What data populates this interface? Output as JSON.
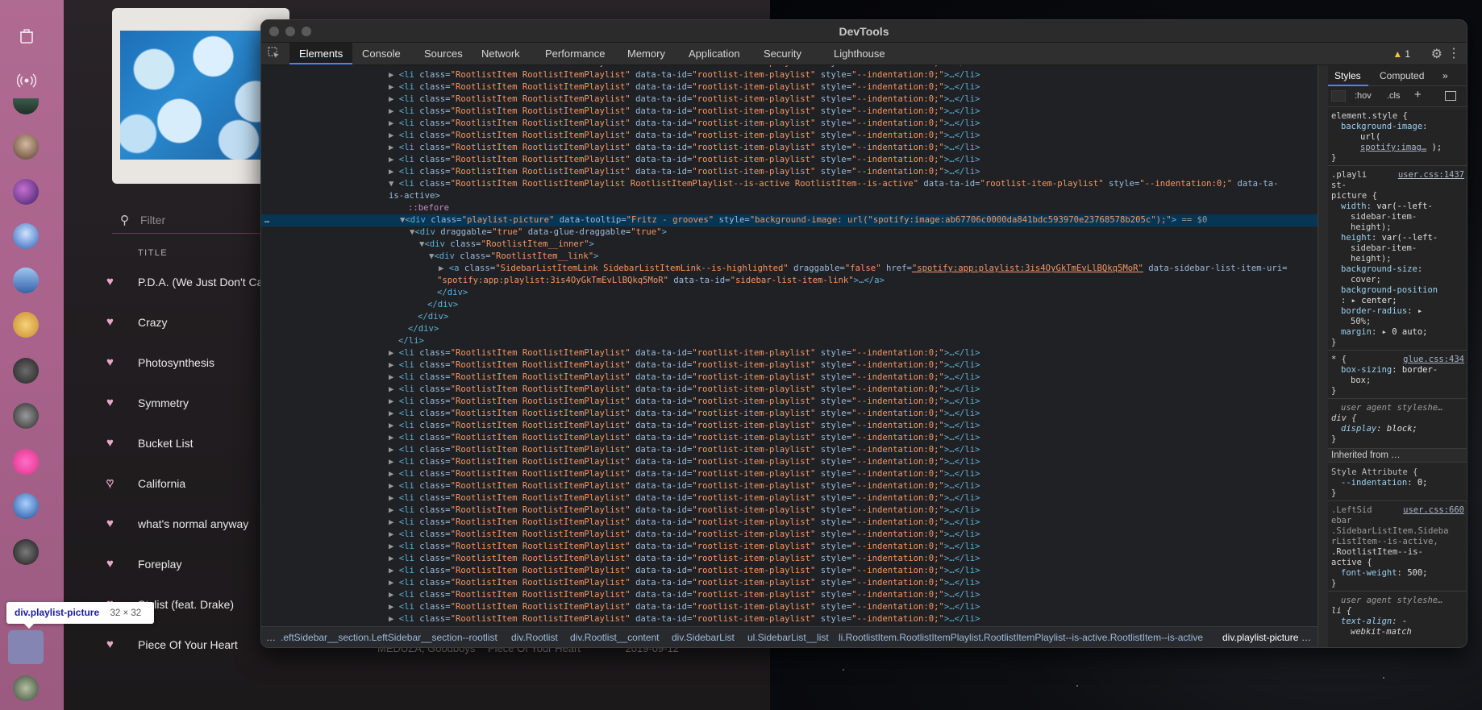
{
  "devtools": {
    "window_title": "DevTools",
    "tabs": [
      "Elements",
      "Console",
      "Sources",
      "Network",
      "Performance",
      "Memory",
      "Application",
      "Security",
      "Lighthouse"
    ],
    "active_tab": "Elements",
    "warning_count": "1",
    "selected_suffix": "== $0",
    "dom_lines_before": 10,
    "dom_lines_after": 23,
    "rootlist_li": {
      "tag_open": "<li",
      "attr1_name": " class=",
      "attr1_value": "\"RootlistItem RootlistItemPlaylist\"",
      "attr2_name": " data-ta-id=",
      "attr2_value": "\"rootlist-item-playlist\"",
      "attr3_name": " style=",
      "attr3_value": "\"--indentation:0;\"",
      "tail": ">…</li>"
    },
    "active_li": {
      "open": "<li",
      "class_attr": " class=",
      "class_value": "\"RootlistItem RootlistItemPlaylist RootlistItemPlaylist--is-active RootlistItem--is-active\"",
      "ta_attr": " data-ta-id=",
      "ta_value": "\"rootlist-item-playlist\"",
      "style_attr": " style=",
      "style_value": "\"--indentation:0;\"",
      "wrap_attr": " data-ta-",
      "wrap_line": "is-active>"
    },
    "before_pseudo": "::before",
    "selected_div": {
      "open": "<div",
      "class_attr": " class=",
      "class_value": "\"playlist-picture\"",
      "tooltip_attr": " data-tooltip=",
      "tooltip_value": "\"Fritz - grooves\"",
      "style_attr": " style=",
      "style_value": "\"background-image: url(\"spotify:image:ab67706c0000da841bdc593970e23768578b205c\");\"",
      "close": ">"
    },
    "drag_div": {
      "open": "<div",
      "a1": " draggable=",
      "v1": "\"true\"",
      "a2": " data-glue-draggable=",
      "v2": "\"true\"",
      "close": ">"
    },
    "inner_div": {
      "open": "<div",
      "a1": " class=",
      "v1": "\"RootlistItem__inner\"",
      "close": ">"
    },
    "link_div": {
      "open": "<div",
      "a1": " class=",
      "v1": "\"RootlistItem__link\"",
      "close": ">"
    },
    "anchor": {
      "open": "<a",
      "a1": " class=",
      "v1": "\"SidebarListItemLink SidebarListItemLink--is-highlighted\"",
      "a2": " draggable=",
      "v2": "\"false\"",
      "a3": " href=",
      "v3": "\"spotify:app:playlist:3is4OyGkTmEvLlBQkq5MoR\"",
      "a4": " data-sidebar-list-item-uri=",
      "line2_value": "\"spotify:app:playlist:3is4OyGkTmEvLlBQkq5MoR\"",
      "a5": " data-ta-id=",
      "v5": "\"sidebar-list-item-link\"",
      "tail": ">…</a>"
    },
    "close_div": "</div>",
    "close_li": "</li>",
    "breadcrumbs": [
      ".eftSidebar__section.LeftSidebar__section--rootlist",
      "div.Rootlist",
      "div.Rootlist__content",
      "div.SidebarList",
      "ul.SidebarList__list",
      "li.RootlistItem.RootlistItemPlaylist.RootlistItemPlaylist--is-active.RootlistItem--is-active",
      "div.playlist-picture"
    ],
    "styles_tabs": [
      "Styles",
      "Computed"
    ],
    "styles_more": "»",
    "styles_filter": {
      "hov": ":hov",
      "cls": ".cls",
      "plus": "+"
    },
    "styles": {
      "element_style": "element.style {",
      "bg_image_prop": "background-image",
      "bg_url_open": "url(",
      "bg_url_link": "spotify:imag…",
      "bg_url_close": ");",
      "close_brace": "}",
      "rule1_selector_a": ".playli",
      "rule1_selector_b": "st-",
      "rule1_selector_c": "picture {",
      "rule1_source": "user.css:1437",
      "width_prop": "width",
      "width_val_a": "var(--left-",
      "width_val_b": "sidebar-item-",
      "width_val_c": "height);",
      "height_prop": "height",
      "height_val_a": "var(--left-",
      "height_val_b": "sidebar-item-",
      "height_val_c": "height);",
      "bgsize_prop": "background-size",
      "bgsize_val": "cover;",
      "bgpos_prop": "background-position",
      "bgpos_val": "center;",
      "radius_prop": "border-radius",
      "radius_val": "50%;",
      "margin_prop": "margin",
      "margin_val": "0 auto;",
      "rule2_selector": "* {",
      "rule2_source": "glue.css:434",
      "boxsizing_prop": "box-sizing",
      "boxsizing_val_a": "border-",
      "boxsizing_val_b": "box;",
      "ua_label": "user agent styleshe…",
      "div_selector": "div {",
      "display_prop": "display",
      "display_val": "block;",
      "inherited_label": "Inherited from …",
      "style_attr_label": "Style Attribute {",
      "indent_prop": "--indentation",
      "indent_val": "0;",
      "rule3_source": "user.css:660",
      "rule3_a": ".LeftSid",
      "rule3_b": "ebar",
      "rule3_c": ".SidebarListItem.Sideba",
      "rule3_d": "rListItem--is-active,",
      "rule3_e": ".RootlistItem--is-",
      "rule3_f": "active {",
      "fontweight_prop": "font-weight",
      "fontweight_val": "500;",
      "ua_label2": "user agent styleshe…",
      "li_selector": "li {",
      "textalign_prop": "text-align",
      "textalign_val": "-",
      "textalign_more": "webkit-match"
    }
  },
  "spotify": {
    "filter_placeholder": "Filter",
    "column_title": "TITLE",
    "tracks": [
      {
        "name": "P.D.A. (We Just Don't Ca",
        "liked": true
      },
      {
        "name": "Crazy",
        "liked": true
      },
      {
        "name": "Photosynthesis",
        "liked": true
      },
      {
        "name": "Symmetry",
        "liked": true
      },
      {
        "name": "Bucket List",
        "liked": true
      },
      {
        "name": "California",
        "liked": false
      },
      {
        "name": "what's normal anyway",
        "liked": true
      },
      {
        "name": "Foreplay",
        "liked": true
      },
      {
        "name": "Stylist (feat. Drake)",
        "liked": true
      },
      {
        "name": "Piece Of Your Heart",
        "liked": true
      }
    ],
    "partial_row": {
      "artist": "MEDUZA, Goodboys",
      "title": "Piece Of Your Heart",
      "date": "2019-09-12"
    }
  },
  "tooltip": {
    "selector": "div.playlist-picture",
    "size": "32 × 32"
  },
  "colors": {
    "accent_blue": "#3a8bff",
    "rail_pink": "#b06b93",
    "heart_pink": "#e6a9c8",
    "selection_bg": "#073655"
  }
}
